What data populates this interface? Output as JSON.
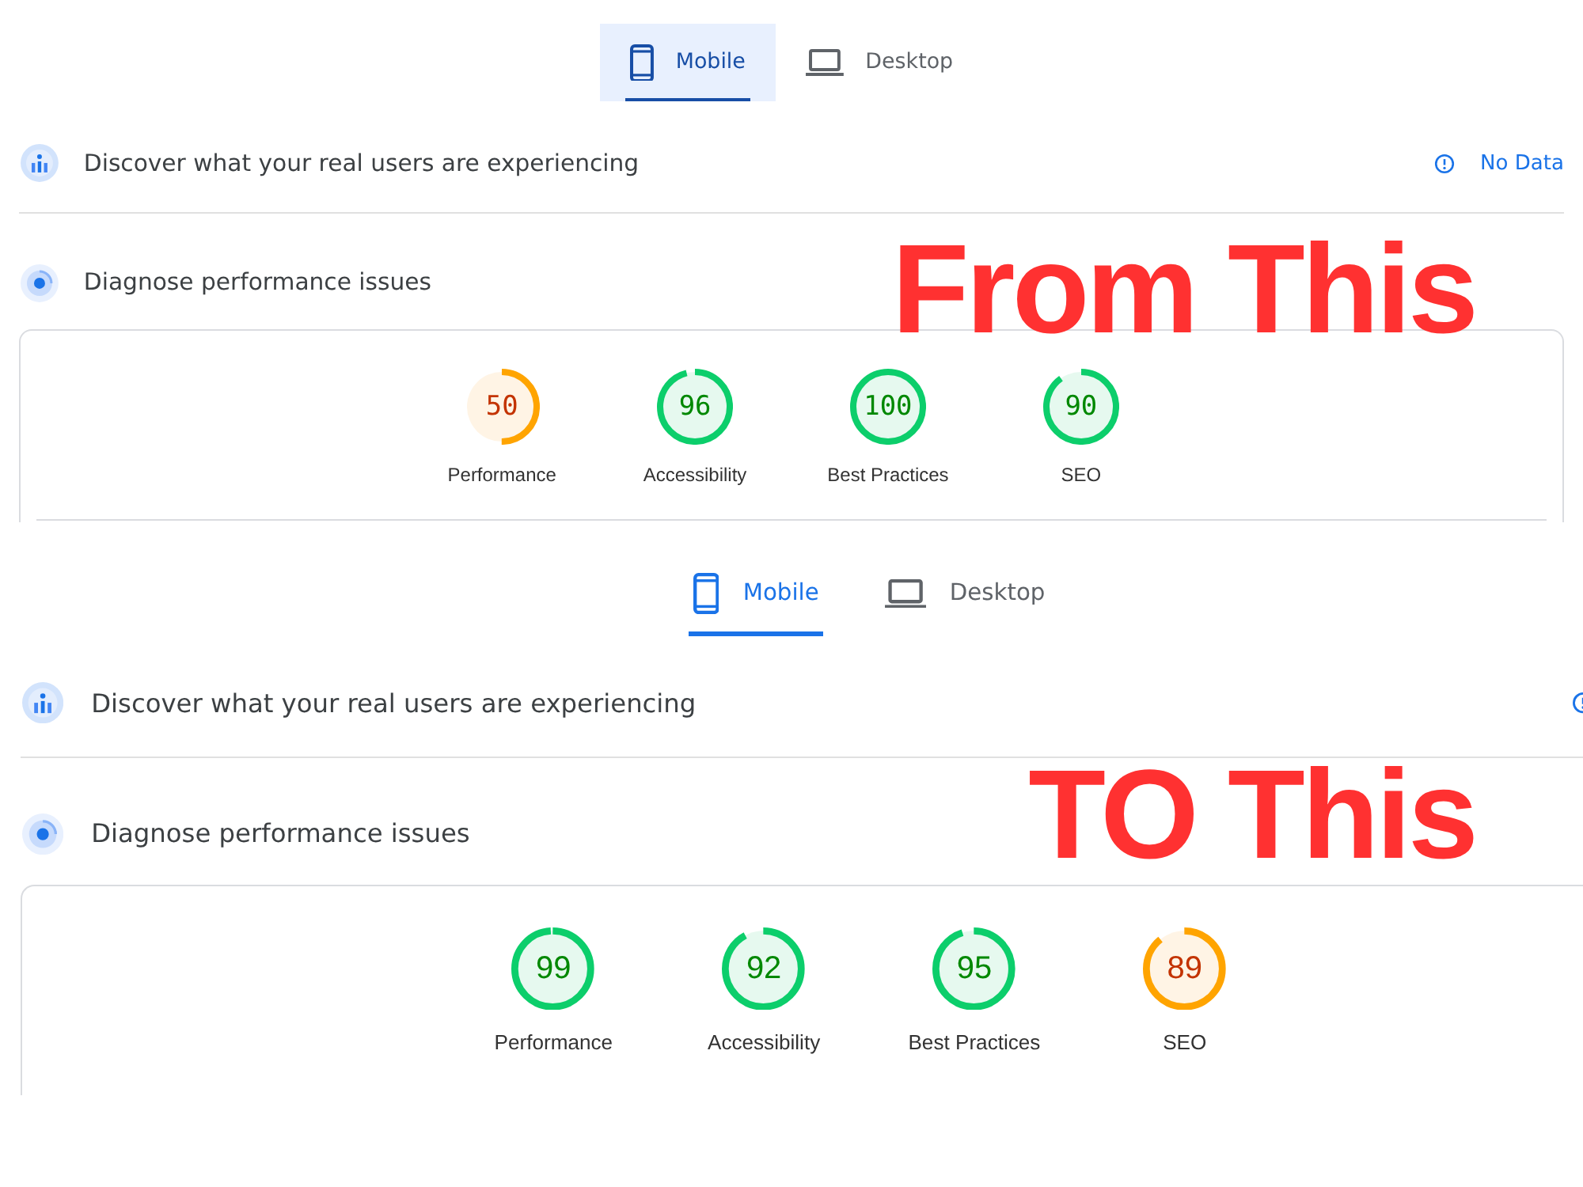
{
  "panels": [
    {
      "tabs": [
        {
          "kind": "mobile",
          "label": "Mobile",
          "selected": true,
          "hovered": true
        },
        {
          "kind": "desktop",
          "label": "Desktop",
          "selected": false,
          "hovered": false
        }
      ],
      "sections": [
        {
          "kind": "field",
          "title": "Discover what your real users are experiencing",
          "status": "No Data"
        },
        {
          "kind": "lab",
          "title": "Diagnose performance issues"
        }
      ],
      "caption": "From This",
      "scores": [
        {
          "value": "50",
          "label": "Performance",
          "level": 0.5
        },
        {
          "value": "96",
          "label": "Accessibility",
          "level": 0.96
        },
        {
          "value": "100",
          "label": "Best Practices",
          "level": 1
        },
        {
          "value": "90",
          "label": "SEO",
          "level": 0.9
        }
      ]
    },
    {
      "tabs": [
        {
          "kind": "mobile",
          "label": "Mobile",
          "selected": true,
          "hovered": false
        },
        {
          "kind": "desktop",
          "label": "Desktop",
          "selected": false,
          "hovered": false
        }
      ],
      "sections": [
        {
          "kind": "field",
          "title": "Discover what your real users are experiencing"
        },
        {
          "kind": "lab",
          "title": "Diagnose performance issues"
        }
      ],
      "caption": "TO This",
      "scores": [
        {
          "value": "99",
          "label": "Performance",
          "level": 0.99
        },
        {
          "value": "92",
          "label": "Accessibility",
          "level": 0.92
        },
        {
          "value": "95",
          "label": "Best Practices",
          "level": 0.95
        },
        {
          "value": "89",
          "label": "SEO",
          "level": 0.89
        }
      ]
    }
  ]
}
